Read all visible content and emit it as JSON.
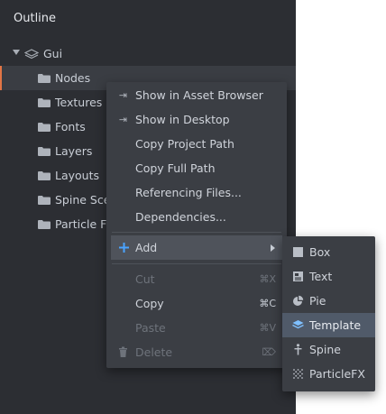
{
  "outline": {
    "title": "Outline",
    "root_label": "Gui",
    "items": [
      {
        "label": "Nodes"
      },
      {
        "label": "Textures"
      },
      {
        "label": "Fonts"
      },
      {
        "label": "Layers"
      },
      {
        "label": "Layouts"
      },
      {
        "label": "Spine Scer"
      },
      {
        "label": "Particle FX"
      }
    ]
  },
  "context_menu": {
    "show_in_asset_browser": "Show in Asset Browser",
    "show_in_desktop": "Show in Desktop",
    "copy_project_path": "Copy Project Path",
    "copy_full_path": "Copy Full Path",
    "referencing_files": "Referencing Files...",
    "dependencies": "Dependencies...",
    "add": "Add",
    "cut": "Cut",
    "cut_shortcut": "⌘X",
    "copy": "Copy",
    "copy_shortcut": "⌘C",
    "paste": "Paste",
    "paste_shortcut": "⌘V",
    "delete": "Delete",
    "delete_shortcut": "⌦"
  },
  "add_submenu": {
    "box": "Box",
    "text": "Text",
    "pie": "Pie",
    "template": "Template",
    "spine": "Spine",
    "particlefx": "ParticleFX"
  },
  "colors": {
    "panel_bg": "#2c2e33",
    "menu_bg": "#3b3e44",
    "selection_accent": "#e27545",
    "submenu_highlight": "#505a69"
  }
}
